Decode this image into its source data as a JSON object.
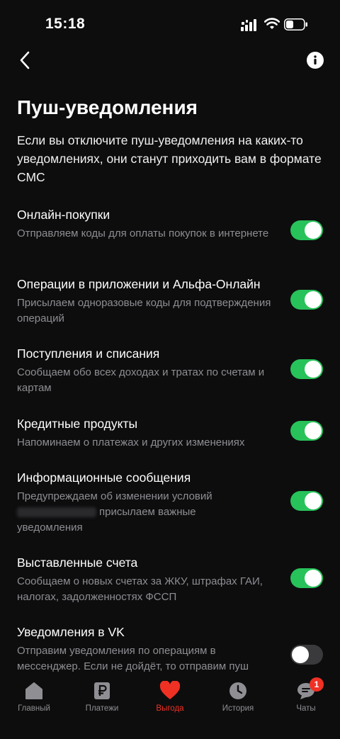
{
  "status_bar": {
    "time": "15:18"
  },
  "header": {
    "title": "Пуш-уведомления"
  },
  "intro": "Если вы отключите пуш-уведомления на каких-то уведомлениях, они станут приходить вам в формате СМС",
  "settings": [
    {
      "title": "Онлайн-покупки",
      "description": "Отправляем коды для оплаты покупок в интернете",
      "enabled": true
    },
    {
      "title": "Операции в приложении и Альфа-Онлайн",
      "description": "Присылаем одноразовые коды для подтверждения операций",
      "enabled": true
    },
    {
      "title": "Поступления и списания",
      "description": "Сообщаем обо всех доходах и тратах по счетам и картам",
      "enabled": true
    },
    {
      "title": "Кредитные продукты",
      "description": "Напоминаем о платежах и других изменениях",
      "enabled": true
    },
    {
      "title": "Информационные сообщения",
      "description_line1": "Предупреждаем об изменении условий",
      "description_line2": "присылаем важные",
      "description_line3": "уведомления",
      "enabled": true
    },
    {
      "title": "Выставленные счета",
      "description": "Сообщаем о новых счетах за ЖКУ, штрафах ГАИ, налогах, задолженностях ФССП",
      "enabled": true
    },
    {
      "title": "Уведомления в VK",
      "description": "Отправим уведомления по операциям в мессенджер. Если не дойдёт, то отправим пуш",
      "enabled": false
    }
  ],
  "tabbar": {
    "tabs": [
      {
        "label": "Главный",
        "icon": "home-icon"
      },
      {
        "label": "Платежи",
        "icon": "ruble-icon"
      },
      {
        "label": "Выгода",
        "icon": "heart-icon",
        "active": true
      },
      {
        "label": "История",
        "icon": "clock-icon"
      },
      {
        "label": "Чаты",
        "icon": "chat-icon",
        "badge": "1"
      }
    ]
  },
  "colors": {
    "accent_red": "#ef3124",
    "toggle_on": "#28c25a",
    "background": "#0d0d0e"
  }
}
